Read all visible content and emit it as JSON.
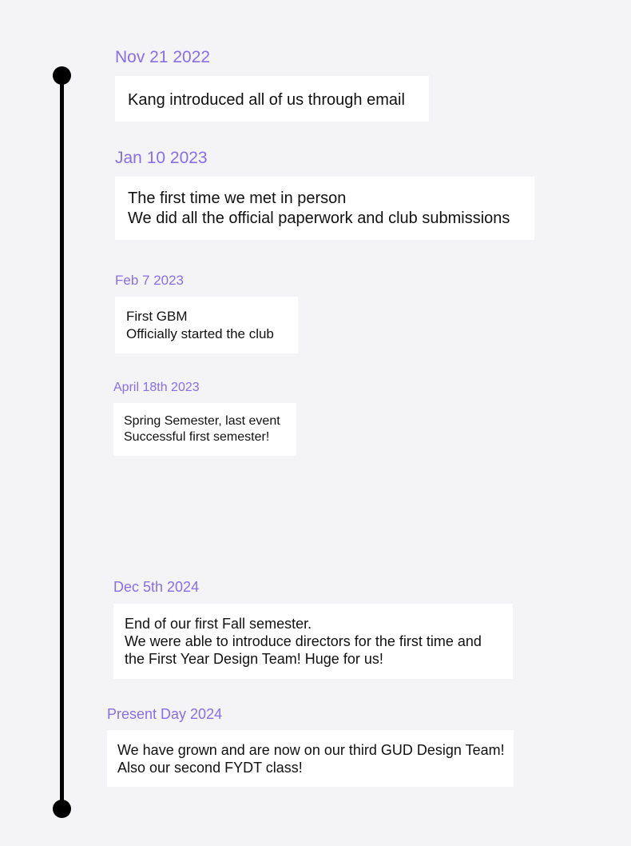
{
  "timeline": {
    "events": [
      {
        "date": "Nov 21 2022",
        "lines": [
          "Kang introduced all of us through email"
        ]
      },
      {
        "date": "Jan 10 2023",
        "lines": [
          "The first time we met in person",
          "We did all the official paperwork and club submissions"
        ]
      },
      {
        "date": "Feb 7 2023",
        "lines": [
          "First GBM",
          "Officially started the club"
        ]
      },
      {
        "date": "April 18th 2023",
        "lines": [
          "Spring Semester, last event",
          "Successful first semester!"
        ]
      },
      {
        "date": "Dec 5th 2024",
        "lines": [
          "End of our first Fall semester.",
          "We were able to introduce directors for the first time and",
          "the First Year Design Team! Huge for us!"
        ]
      },
      {
        "date": "Present Day 2024",
        "lines": [
          "We have grown and are now on our third GUD Design Team!",
          "Also our second FYDT class!"
        ]
      }
    ]
  }
}
